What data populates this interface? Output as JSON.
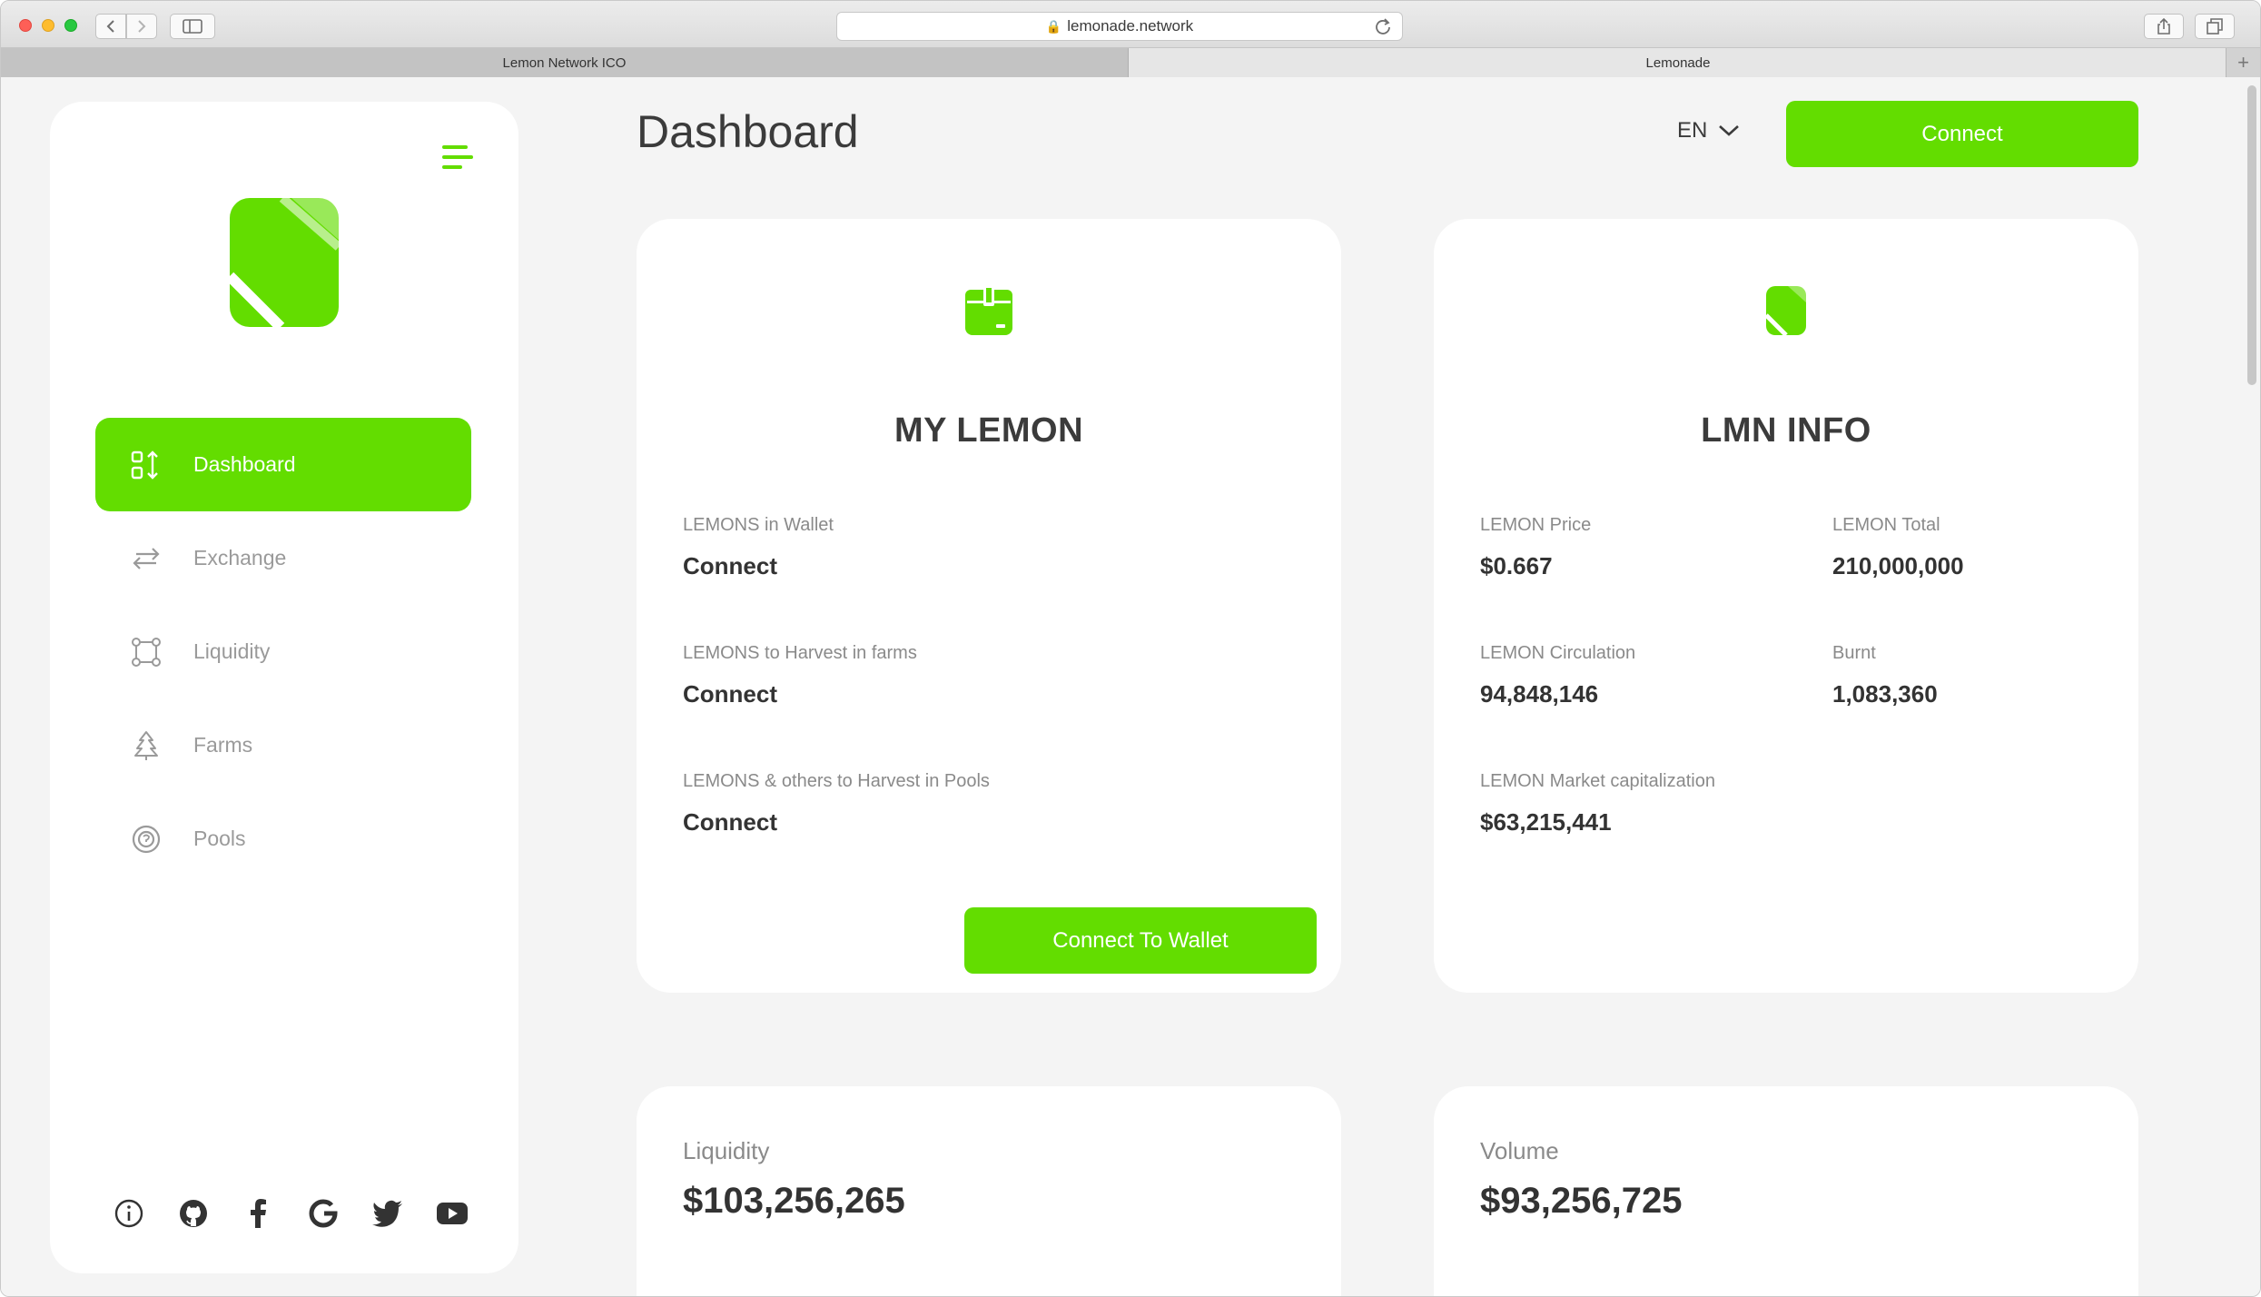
{
  "browser": {
    "url": "lemonade.network",
    "tabs": [
      {
        "label": "Lemon Network ICO",
        "active": false
      },
      {
        "label": "Lemonade",
        "active": true
      }
    ],
    "new_tab_label": "+"
  },
  "sidebar": {
    "items": [
      {
        "label": "Dashboard",
        "icon": "dashboard-icon",
        "active": true
      },
      {
        "label": "Exchange",
        "icon": "exchange-icon",
        "active": false
      },
      {
        "label": "Liquidity",
        "icon": "liquidity-icon",
        "active": false
      },
      {
        "label": "Farms",
        "icon": "farms-icon",
        "active": false
      },
      {
        "label": "Pools",
        "icon": "pools-icon",
        "active": false
      }
    ],
    "socials": [
      "info-icon",
      "github-icon",
      "facebook-icon",
      "google-icon",
      "twitter-icon",
      "youtube-icon"
    ]
  },
  "header": {
    "title": "Dashboard",
    "language": "EN",
    "connect_label": "Connect"
  },
  "my_lemon": {
    "title": "MY LEMON",
    "fields": [
      {
        "label": "LEMONS in Wallet",
        "value": "Connect"
      },
      {
        "label": "LEMONS to Harvest in farms",
        "value": "Connect"
      },
      {
        "label": "LEMONS & others to Harvest in Pools",
        "value": "Connect"
      }
    ],
    "button_label": "Connect To Wallet"
  },
  "lmn_info": {
    "title": "LMN INFO",
    "fields": [
      {
        "label": "LEMON Price",
        "value": "$0.667"
      },
      {
        "label": "LEMON Total",
        "value": "210,000,000"
      },
      {
        "label": "LEMON Circulation",
        "value": "94,848,146"
      },
      {
        "label": "Burnt",
        "value": "1,083,360"
      },
      {
        "label": "LEMON Market capitalization",
        "value": "$63,215,441"
      }
    ]
  },
  "stats": {
    "liquidity": {
      "label": "Liquidity",
      "value": "$103,256,265"
    },
    "volume": {
      "label": "Volume",
      "value": "$93,256,725"
    }
  },
  "colors": {
    "accent": "#63dd00",
    "page_bg": "#f4f4f4",
    "card_bg": "#ffffff",
    "text_dark": "#3b3b3b",
    "text_muted": "#8a8a8a"
  }
}
